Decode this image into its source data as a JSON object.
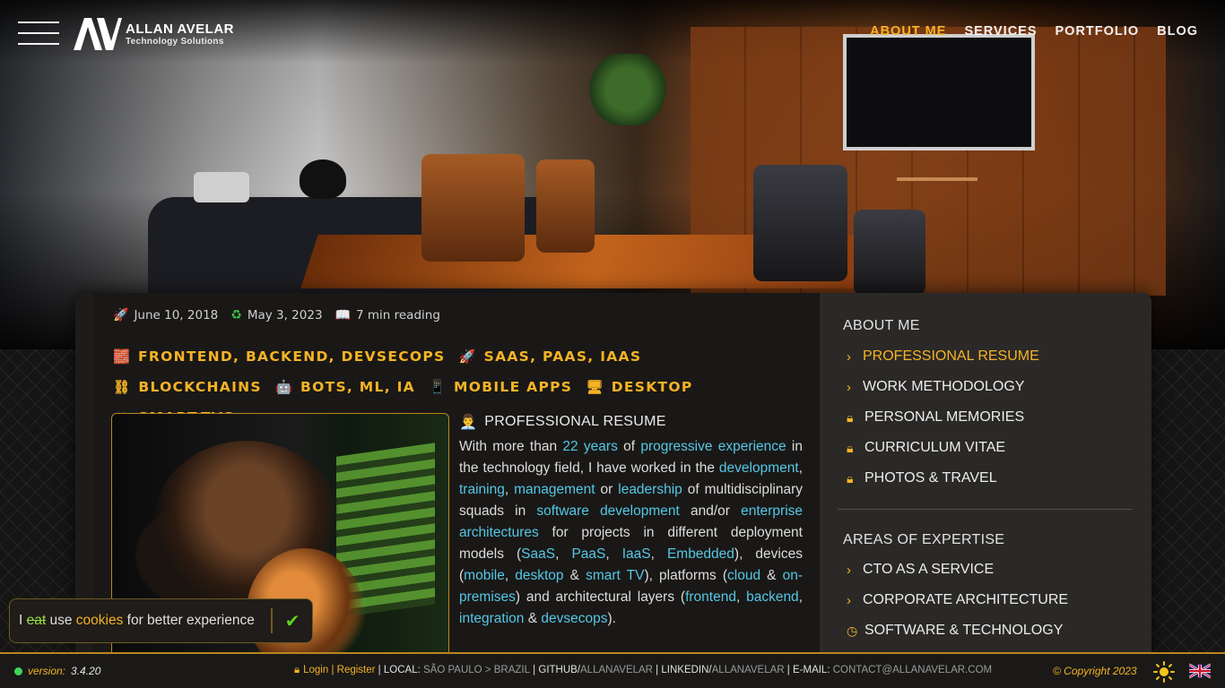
{
  "brand": {
    "name": "ALLAN AVELAR",
    "tagline": "Technology Solutions"
  },
  "nav": {
    "items": [
      {
        "label": "ABOUT ME",
        "active": true
      },
      {
        "label": "SERVICES",
        "active": false
      },
      {
        "label": "PORTFOLIO",
        "active": false
      },
      {
        "label": "BLOG",
        "active": false
      }
    ]
  },
  "meta": {
    "published": "June 10, 2018",
    "updated": "May 3, 2023",
    "reading": "7 min reading",
    "icons": [
      "rocket-icon",
      "recycle-icon",
      "reading-icon"
    ]
  },
  "tags": [
    {
      "icon": "brick-icon",
      "label": "FRONTEND, BACKEND, DEVSECOPS"
    },
    {
      "icon": "rocket-icon",
      "label": "SAAS, PAAS, IAAS"
    },
    {
      "icon": "chain-icon",
      "label": "BLOCKCHAINS"
    },
    {
      "icon": "robot-icon",
      "label": "BOTS, ML, IA"
    },
    {
      "icon": "phone-icon",
      "label": "MOBILE APPS"
    },
    {
      "icon": "desktop-icon",
      "label": "DESKTOP"
    },
    {
      "icon": "tv-icon",
      "label": "SMART-TVS"
    }
  ],
  "article": {
    "title": "PROFESSIONAL RESUME",
    "p": {
      "t1": "With more than ",
      "l1": "22 years",
      "t2": " of ",
      "l2": "progressive experience",
      "t3": " in the technology field, I have worked in the ",
      "l3": "development",
      "t4": ", ",
      "l4": "training",
      "t5": ", ",
      "l5": "management",
      "t6": " or ",
      "l6": "leadership",
      "t7": " of multidisciplinary squads in ",
      "l7": "software development",
      "t8": " and/or ",
      "l8": "enterprise architectures",
      "t9": " for projects in different deployment models (",
      "l9": "SaaS",
      "t10": ", ",
      "l10": "PaaS",
      "t11": ", ",
      "l11": "IaaS",
      "t12": ", ",
      "l12": "Embedded",
      "t13": "), devices (",
      "l13": "mobile",
      "t14": ", ",
      "l14": "desktop",
      "t15": " & ",
      "l15": "smart TV",
      "t16": "), platforms (",
      "l16": "cloud",
      "t17": " & ",
      "l17": "on-premises",
      "t18": ") and architectural layers (",
      "l18": "frontend",
      "t19": ", ",
      "l19": "backend",
      "t20": ", ",
      "l20": "integration",
      "t21": " & ",
      "l21": "devsecops",
      "t22": ")."
    }
  },
  "sidebar": {
    "about_heading": "ABOUT ME",
    "about_items": [
      {
        "label": "PROFESSIONAL RESUME",
        "icon": "chevron-right-icon",
        "active": true
      },
      {
        "label": "WORK METHODOLOGY",
        "icon": "chevron-right-icon",
        "active": false
      },
      {
        "label": "PERSONAL MEMORIES",
        "icon": "lock-icon",
        "active": false
      },
      {
        "label": "CURRICULUM VITAE",
        "icon": "lock-icon",
        "active": false
      },
      {
        "label": "PHOTOS & TRAVEL",
        "icon": "lock-icon",
        "active": false
      }
    ],
    "expertise_heading": "AREAS OF EXPERTISE",
    "expertise_items": [
      {
        "label": "CTO AS A SERVICE",
        "icon": "chevron-right-icon"
      },
      {
        "label": "CORPORATE ARCHITECTURE",
        "icon": "chevron-right-icon"
      },
      {
        "label": "SOFTWARE & TECHNOLOGY",
        "icon": "clock-icon"
      }
    ]
  },
  "cookie": {
    "t1": "I ",
    "strike": "eat",
    "t2": " use ",
    "link": "cookies",
    "t3": " for better experience"
  },
  "footer": {
    "version_label": "version:",
    "version": "3.4.20",
    "login": "Login",
    "register": "Register",
    "local_label": "LOCAL:",
    "local_value": "SÃO PAULO > BRAZIL",
    "github_label": "GITHUB/",
    "github_value": "ALLANAVELAR",
    "linkedin_label": "LINKEDIN/",
    "linkedin_value": "ALLANAVELAR",
    "email_label": "E-MAIL:",
    "email_value": "CONTACT@ALLANAVELAR.COM",
    "copyright": "© Copyright 2023"
  },
  "colors": {
    "accent": "#f5b325",
    "link": "#53c8e6",
    "ok": "#5fd11f"
  }
}
